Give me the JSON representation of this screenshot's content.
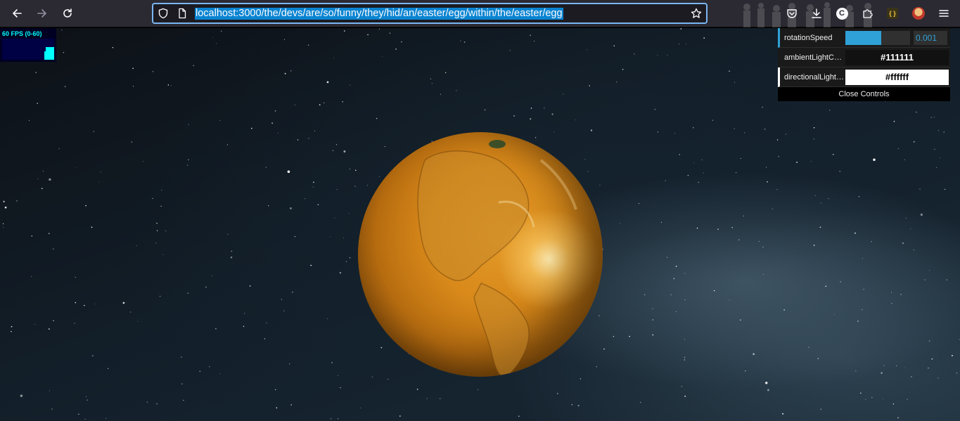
{
  "browser": {
    "url": "localhost:3000/the/devs/are/so/funny/they/hid/an/easter/egg/within/the/easter/egg",
    "extension_badge_letter": "C",
    "json_badge": "{ }"
  },
  "stats": {
    "fps_label": "60 FPS (0-60)"
  },
  "controls": {
    "rotation_speed": {
      "label": "rotationSpeed",
      "value": "0.001",
      "fraction": 0.55
    },
    "ambient_light": {
      "label": "ambientLightColor",
      "value": "#111111"
    },
    "directional_light": {
      "label": "directionalLightColor",
      "value": "#ffffff"
    },
    "close_label": "Close Controls"
  },
  "colors": {
    "accent": "#2fa1d6",
    "toolbar_bg": "#2b2a33",
    "url_highlight": "#0a84d1",
    "planet": "#d8891a"
  }
}
